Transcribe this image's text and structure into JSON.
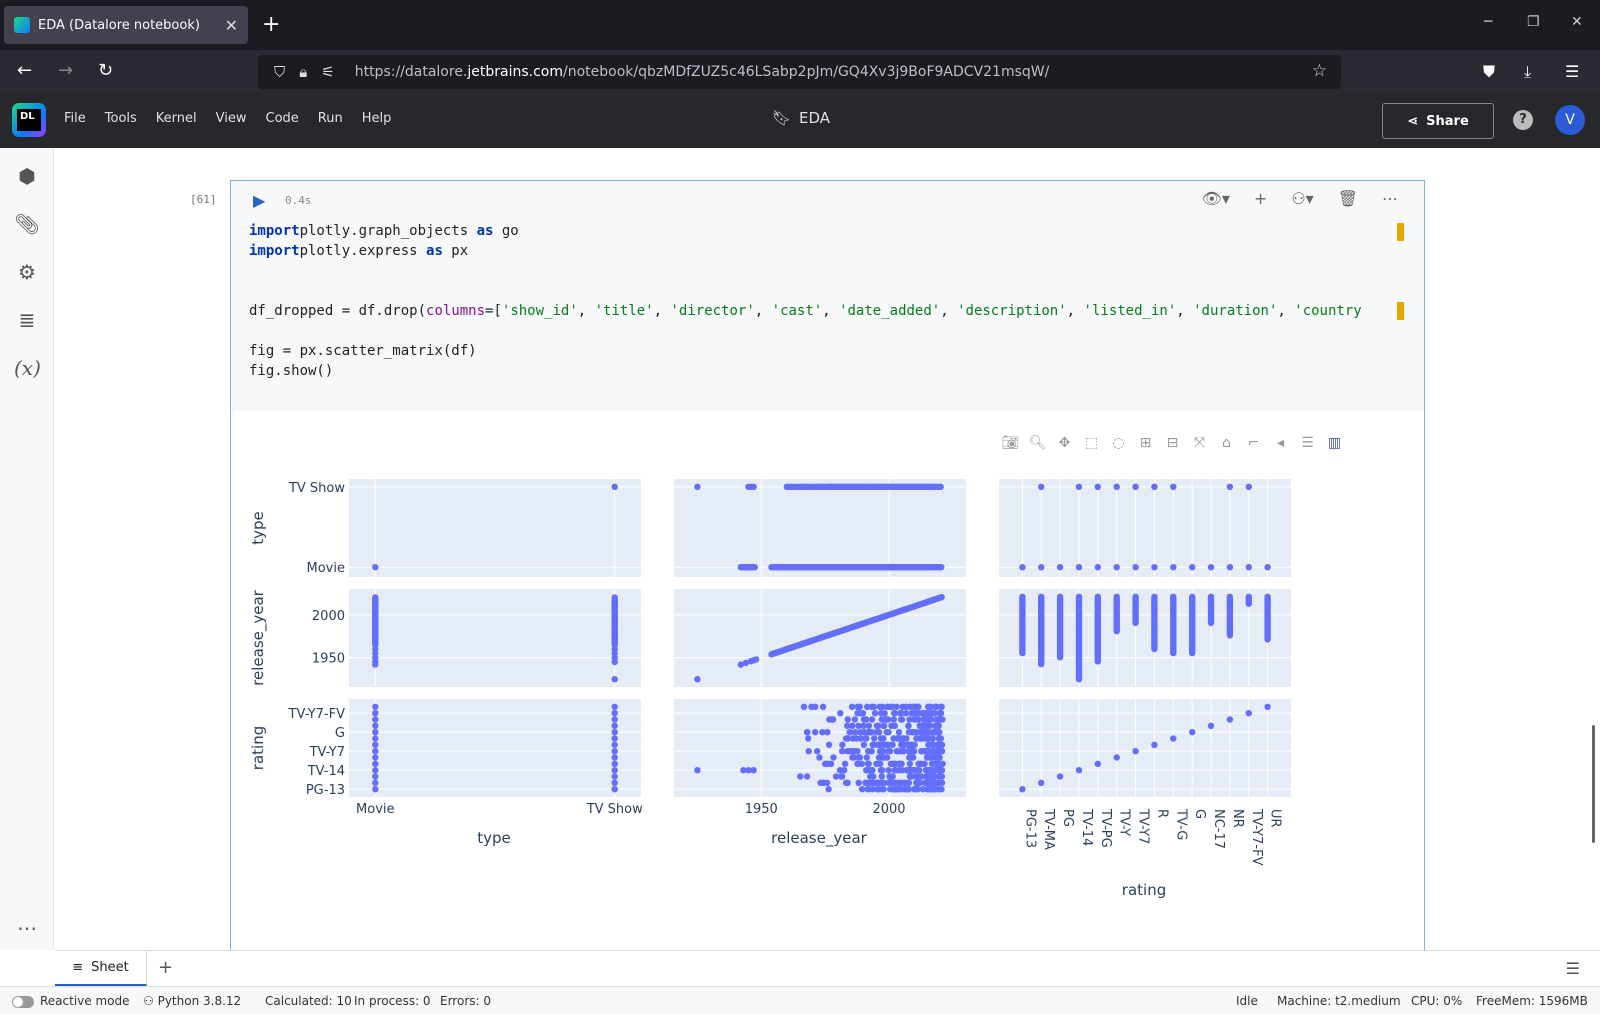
{
  "browser": {
    "tab_title": "EDA (Datalore notebook)",
    "url_host_prefix": "https://datalore.",
    "url_host_main": "jetbrains.com",
    "url_path": "/notebook/qbzMDfZUZ5c46LSabp2pJm/GQ4Xv3j9BoF9ADCV21msqW/"
  },
  "app": {
    "logo_text": "DL",
    "menu": [
      "File",
      "Tools",
      "Kernel",
      "View",
      "Code",
      "Run",
      "Help"
    ],
    "notebook_title": "EDA",
    "share_label": "Share",
    "help_label": "?",
    "avatar_letter": "V"
  },
  "cell": {
    "exec_count": "[61]",
    "timing": "0.4s",
    "code_lines": [
      {
        "t": [
          [
            "kw",
            "import"
          ],
          [
            "",
            "plotly.graph_objects "
          ],
          [
            "kw",
            "as"
          ],
          [
            "",
            " go"
          ]
        ]
      },
      {
        "t": [
          [
            "kw",
            "import"
          ],
          [
            "",
            "plotly.express "
          ],
          [
            "kw",
            "as"
          ],
          [
            "",
            " px"
          ]
        ]
      },
      {
        "t": []
      },
      {
        "t": []
      },
      {
        "t": [
          [
            "",
            "df_dropped = df.drop("
          ],
          [
            "prm",
            "columns"
          ],
          [
            "",
            "=["
          ],
          [
            "str",
            "'show_id'"
          ],
          [
            "",
            ", "
          ],
          [
            "str",
            "'title'"
          ],
          [
            "",
            ", "
          ],
          [
            "str",
            "'director'"
          ],
          [
            "",
            ", "
          ],
          [
            "str",
            "'cast'"
          ],
          [
            "",
            ", "
          ],
          [
            "str",
            "'date_added'"
          ],
          [
            "",
            ", "
          ],
          [
            "str",
            "'description'"
          ],
          [
            "",
            ", "
          ],
          [
            "str",
            "'listed_in'"
          ],
          [
            "",
            ", "
          ],
          [
            "str",
            "'duration'"
          ],
          [
            "",
            ", "
          ],
          [
            "str",
            "'country"
          ]
        ]
      },
      {
        "t": []
      },
      {
        "t": [
          [
            "",
            "fig = px.scatter_matrix(df)"
          ]
        ]
      },
      {
        "t": [
          [
            "",
            "fig.show()"
          ]
        ]
      }
    ]
  },
  "chart_data": {
    "type": "scatter",
    "title": "",
    "dimensions": [
      "type",
      "release_year",
      "rating"
    ],
    "type_categories": [
      "Movie",
      "TV Show"
    ],
    "release_year_ticks": [
      1950,
      2000
    ],
    "release_year_range": [
      1925,
      2021
    ],
    "rating_axis_x_labels": [
      "PG-13",
      "TV-MA",
      "PG",
      "TV-14",
      "TV-PG",
      "TV-Y",
      "TV-Y7",
      "R",
      "TV-G",
      "G",
      "NC-17",
      "NR",
      "TV-Y7-FV",
      "UR"
    ],
    "rating_axis_y_labels": [
      "TV-Y7-FV",
      "G",
      "TV-Y7",
      "TV-14",
      "PG-13"
    ],
    "marker_color": "#636efa",
    "grid": true
  },
  "sheets": {
    "tab_label": "Sheet",
    "add_label": "+"
  },
  "status": {
    "reactive": "Reactive mode",
    "python": "Python 3.8.12",
    "calculated": "Calculated: 10",
    "in_process": "In process: 0",
    "errors": "Errors: 0",
    "state": "Idle",
    "machine": "Machine: t2.medium",
    "cpu": "CPU: 0%",
    "freemem": "FreeMem: 1596MB"
  }
}
